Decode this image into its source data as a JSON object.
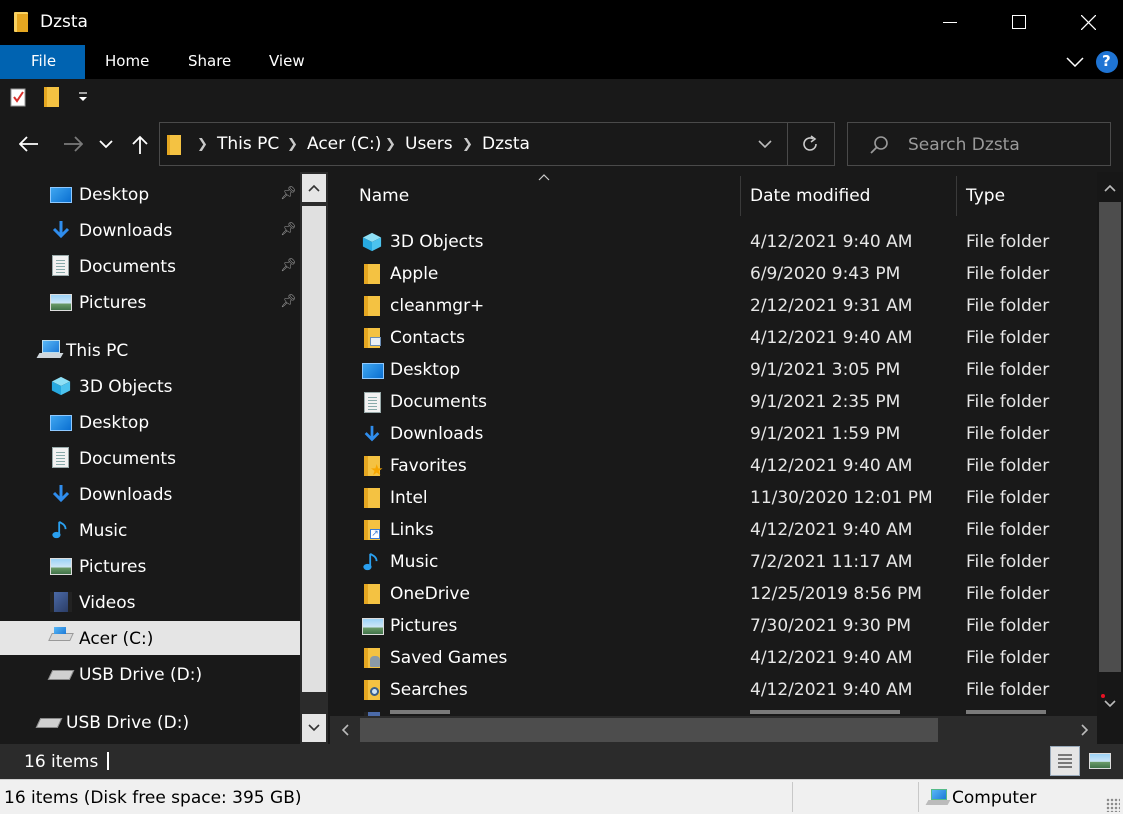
{
  "window": {
    "title": "Dzsta",
    "controls": {
      "minimize": "—",
      "maximize": "☐",
      "close": "✕"
    }
  },
  "ribbon": {
    "tabs": [
      {
        "label": "File",
        "active": true
      },
      {
        "label": "Home",
        "active": false
      },
      {
        "label": "Share",
        "active": false
      },
      {
        "label": "View",
        "active": false
      }
    ],
    "help": "?"
  },
  "address": {
    "breadcrumb": [
      "This PC",
      "Acer (C:)",
      "Users",
      "Dzsta"
    ],
    "search_placeholder": "Search Dzsta"
  },
  "sidebar": {
    "quick_access": [
      {
        "label": "Desktop",
        "icon": "desktop-icon",
        "pinned": true
      },
      {
        "label": "Downloads",
        "icon": "downloads-icon",
        "pinned": true
      },
      {
        "label": "Documents",
        "icon": "documents-icon",
        "pinned": true
      },
      {
        "label": "Pictures",
        "icon": "pictures-icon",
        "pinned": true
      }
    ],
    "this_pc": {
      "label": "This PC",
      "icon": "this-pc-icon"
    },
    "pc_items": [
      {
        "label": "3D Objects",
        "icon": "3d-objects-icon"
      },
      {
        "label": "Desktop",
        "icon": "desktop-icon"
      },
      {
        "label": "Documents",
        "icon": "documents-icon"
      },
      {
        "label": "Downloads",
        "icon": "downloads-icon"
      },
      {
        "label": "Music",
        "icon": "music-icon"
      },
      {
        "label": "Pictures",
        "icon": "pictures-icon"
      },
      {
        "label": "Videos",
        "icon": "videos-icon"
      },
      {
        "label": "Acer (C:)",
        "icon": "drive-icon",
        "selected": true
      },
      {
        "label": "USB Drive (D:)",
        "icon": "usb-drive-icon"
      }
    ],
    "usb_root": {
      "label": "USB Drive (D:)",
      "icon": "usb-drive-icon"
    }
  },
  "columns": {
    "name": "Name",
    "date": "Date modified",
    "type": "Type"
  },
  "files": [
    {
      "name": "3D Objects",
      "date": "4/12/2021 9:40 AM",
      "type": "File folder",
      "icon": "3d-objects-icon"
    },
    {
      "name": "Apple",
      "date": "6/9/2020 9:43 PM",
      "type": "File folder",
      "icon": "folder-icon"
    },
    {
      "name": "cleanmgr+",
      "date": "2/12/2021 9:31 AM",
      "type": "File folder",
      "icon": "folder-icon"
    },
    {
      "name": "Contacts",
      "date": "4/12/2021 9:40 AM",
      "type": "File folder",
      "icon": "contacts-icon"
    },
    {
      "name": "Desktop",
      "date": "9/1/2021 3:05 PM",
      "type": "File folder",
      "icon": "desktop-icon"
    },
    {
      "name": "Documents",
      "date": "9/1/2021 2:35 PM",
      "type": "File folder",
      "icon": "documents-icon"
    },
    {
      "name": "Downloads",
      "date": "9/1/2021 1:59 PM",
      "type": "File folder",
      "icon": "downloads-icon"
    },
    {
      "name": "Favorites",
      "date": "4/12/2021 9:40 AM",
      "type": "File folder",
      "icon": "favorites-icon"
    },
    {
      "name": "Intel",
      "date": "11/30/2020 12:01 PM",
      "type": "File folder",
      "icon": "folder-icon"
    },
    {
      "name": "Links",
      "date": "4/12/2021 9:40 AM",
      "type": "File folder",
      "icon": "links-icon"
    },
    {
      "name": "Music",
      "date": "7/2/2021 11:17 AM",
      "type": "File folder",
      "icon": "music-icon"
    },
    {
      "name": "OneDrive",
      "date": "12/25/2019 8:56 PM",
      "type": "File folder",
      "icon": "folder-icon"
    },
    {
      "name": "Pictures",
      "date": "7/30/2021 9:30 PM",
      "type": "File folder",
      "icon": "pictures-icon"
    },
    {
      "name": "Saved Games",
      "date": "4/12/2021 9:40 AM",
      "type": "File folder",
      "icon": "saved-games-icon"
    },
    {
      "name": "Searches",
      "date": "4/12/2021 9:40 AM",
      "type": "File folder",
      "icon": "searches-icon"
    }
  ],
  "status": {
    "item_count": "16 items",
    "bottom_text": "16 items (Disk free space: 395 GB)",
    "computer_label": "Computer"
  },
  "colors": {
    "accent": "#0063b1",
    "selected_row": "#e5e5e5",
    "titlebar": "#000000",
    "background": "#191919"
  }
}
